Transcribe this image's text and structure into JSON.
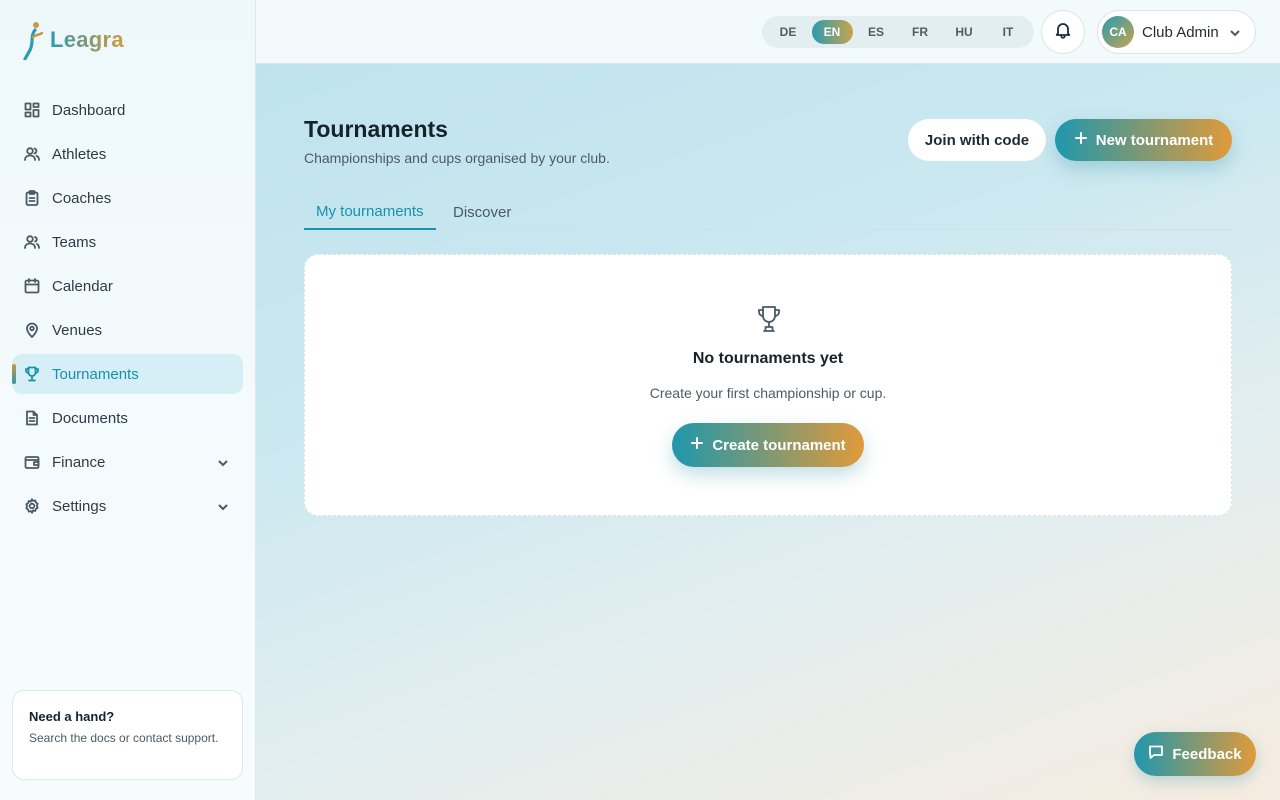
{
  "brand": {
    "name": "Leagra"
  },
  "sidebar": {
    "items": [
      {
        "label": "Dashboard",
        "icon": "dashboard-icon"
      },
      {
        "label": "Athletes",
        "icon": "users-icon"
      },
      {
        "label": "Coaches",
        "icon": "clipboard-icon"
      },
      {
        "label": "Teams",
        "icon": "team-icon"
      },
      {
        "label": "Calendar",
        "icon": "calendar-icon"
      },
      {
        "label": "Venues",
        "icon": "map-pin-icon"
      },
      {
        "label": "Tournaments",
        "icon": "trophy-icon",
        "active": true
      },
      {
        "label": "Documents",
        "icon": "document-icon"
      },
      {
        "label": "Finance",
        "icon": "wallet-icon",
        "expandable": true
      },
      {
        "label": "Settings",
        "icon": "gear-icon",
        "expandable": true
      }
    ],
    "help": {
      "title": "Need a hand?",
      "text": "Search the docs or contact support."
    }
  },
  "topbar": {
    "languages": [
      "DE",
      "EN",
      "ES",
      "FR",
      "HU",
      "IT"
    ],
    "active_language": "EN",
    "user": {
      "initials": "CA",
      "name": "Club Admin"
    }
  },
  "page": {
    "title": "Tournaments",
    "subtitle": "Championships and cups organised by your club.",
    "join_label": "Join with code",
    "new_label": "New tournament",
    "tabs": [
      {
        "label": "My tournaments",
        "active": true
      },
      {
        "label": "Discover",
        "active": false
      }
    ],
    "empty": {
      "title": "No tournaments yet",
      "text": "Create your first championship or cup.",
      "button": "Create tournament"
    }
  },
  "feedback": {
    "label": "Feedback"
  },
  "colors": {
    "accent": "#1792ad",
    "gradient_start": "#1f97ad",
    "gradient_end": "#e09a3a"
  }
}
